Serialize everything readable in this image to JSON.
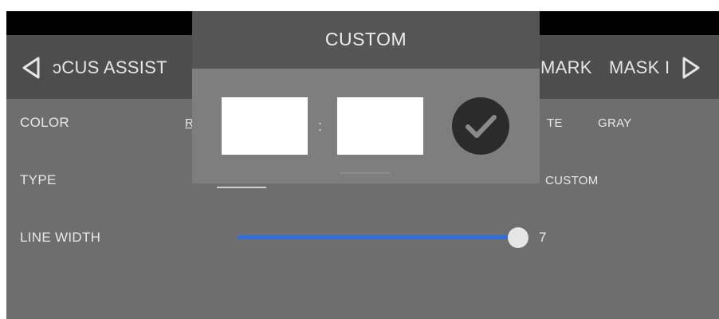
{
  "navbar": {
    "left_item": "ɔCUS ASSIST",
    "right_item_1": "MARK",
    "right_item_2": "MASK I"
  },
  "settings": {
    "color": {
      "label": "COLOR",
      "options": [
        "R",
        "TE",
        "GRAY"
      ]
    },
    "type": {
      "label": "TYPE",
      "custom_option": "CUSTOM"
    },
    "line_width": {
      "label": "LINE WIDTH",
      "value": "7",
      "slider_fraction": 1.0
    }
  },
  "dialog": {
    "title": "CUSTOM",
    "field_left_value": "",
    "separator": ":",
    "field_right_value": ""
  },
  "colors": {
    "background": "#6e6e6e",
    "navbar": "#4d4d4d",
    "dialog_header": "#555555",
    "dialog_body": "#7e7e7e",
    "slider_accent": "#2e6fe0"
  },
  "icons": {
    "nav_left": "chevron-left-icon",
    "nav_right": "chevron-right-icon",
    "confirm": "checkmark-icon"
  }
}
